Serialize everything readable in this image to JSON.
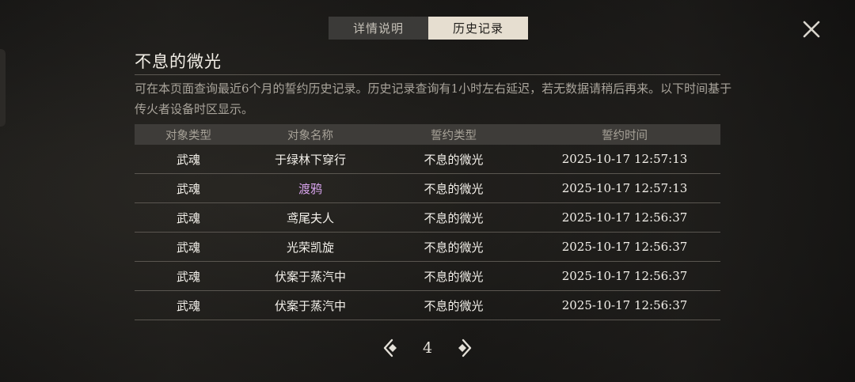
{
  "tabs": [
    {
      "label": "详情说明",
      "active": false
    },
    {
      "label": "历史记录",
      "active": true
    }
  ],
  "title": "不息的微光",
  "description": "可在本页面查询最近6个月的誓约历史记录。历史记录查询有1小时左右延迟，若无数据请稍后再来。以下时间基于传火者设备时区显示。",
  "table": {
    "headers": [
      "对象类型",
      "对象名称",
      "誓约类型",
      "誓约时间"
    ],
    "rows": [
      {
        "type": "武魂",
        "name": "于绿林下穿行",
        "oath": "不息的微光",
        "time": "2025-10-17 12:57:13"
      },
      {
        "type": "武魂",
        "name": "渡鸦",
        "oath": "不息的微光",
        "time": "2025-10-17 12:57:13"
      },
      {
        "type": "武魂",
        "name": "鸢尾夫人",
        "oath": "不息的微光",
        "time": "2025-10-17 12:56:37"
      },
      {
        "type": "武魂",
        "name": "光荣凯旋",
        "oath": "不息的微光",
        "time": "2025-10-17 12:56:37"
      },
      {
        "type": "武魂",
        "name": "伏案于蒸汽中",
        "oath": "不息的微光",
        "time": "2025-10-17 12:56:37"
      },
      {
        "type": "武魂",
        "name": "伏案于蒸汽中",
        "oath": "不息的微光",
        "time": "2025-10-17 12:56:37"
      }
    ]
  },
  "pager": {
    "page": "4",
    "prev_icon": "prev-page-icon",
    "next_icon": "next-page-icon"
  },
  "colors": {
    "highlight_name": "#d7a3ec",
    "active_tab": "#e6ded0",
    "inactive_tab": "#3b3a38"
  }
}
